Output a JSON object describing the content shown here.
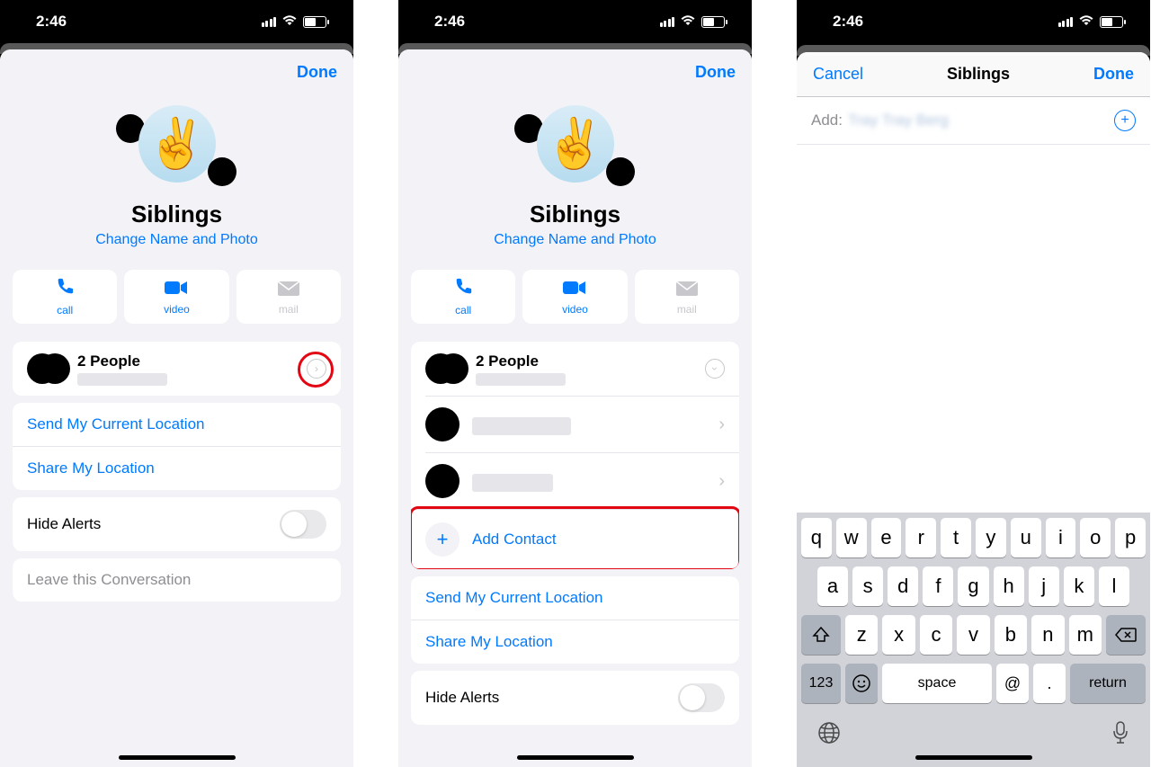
{
  "status": {
    "time": "2:46"
  },
  "screen1": {
    "nav": {
      "done": "Done"
    },
    "group": {
      "title": "Siblings",
      "subtitle": "Change Name and Photo",
      "emoji": "✌️"
    },
    "actions": {
      "call": "call",
      "video": "video",
      "mail": "mail"
    },
    "people": {
      "count_label": "2 People"
    },
    "location": {
      "send": "Send My Current Location",
      "share": "Share My Location"
    },
    "alerts": {
      "label": "Hide Alerts"
    },
    "leave": {
      "label": "Leave this Conversation"
    }
  },
  "screen2": {
    "nav": {
      "done": "Done"
    },
    "group": {
      "title": "Siblings",
      "subtitle": "Change Name and Photo",
      "emoji": "✌️"
    },
    "actions": {
      "call": "call",
      "video": "video",
      "mail": "mail"
    },
    "people": {
      "count_label": "2 People"
    },
    "add_contact": "Add Contact",
    "location": {
      "send": "Send My Current Location",
      "share": "Share My Location"
    },
    "alerts": {
      "label": "Hide Alerts"
    }
  },
  "screen3": {
    "nav": {
      "cancel": "Cancel",
      "title": "Siblings",
      "done": "Done"
    },
    "add_field": {
      "label": "Add:",
      "value_placeholder": "Tray Tray Berg"
    },
    "keyboard": {
      "row1": [
        "q",
        "w",
        "e",
        "r",
        "t",
        "y",
        "u",
        "i",
        "o",
        "p"
      ],
      "row2": [
        "a",
        "s",
        "d",
        "f",
        "g",
        "h",
        "j",
        "k",
        "l"
      ],
      "row3_shift": "⇧",
      "row3": [
        "z",
        "x",
        "c",
        "v",
        "b",
        "n",
        "m"
      ],
      "row3_backspace": "⌫",
      "row4": {
        "numbers": "123",
        "emoji": "☺",
        "space": "space",
        "at": "@",
        "period": ".",
        "return": "return"
      }
    }
  }
}
